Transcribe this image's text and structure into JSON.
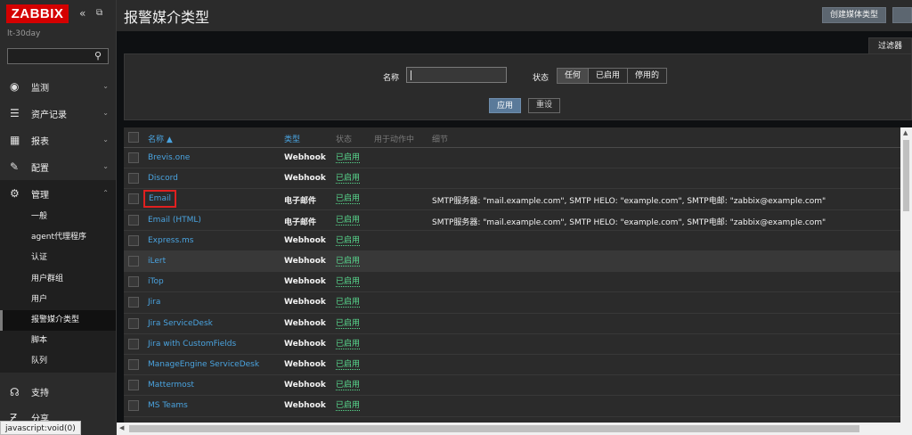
{
  "app": {
    "logo": "ZABBIX",
    "server_name": "lt-30day"
  },
  "search": {
    "value": "",
    "placeholder": ""
  },
  "menu": [
    {
      "label": "监测",
      "icon": "eye-icon"
    },
    {
      "label": "资产记录",
      "icon": "list-icon"
    },
    {
      "label": "报表",
      "icon": "chart-icon"
    },
    {
      "label": "配置",
      "icon": "wrench-icon"
    },
    {
      "label": "管理",
      "icon": "gear-icon"
    }
  ],
  "submenu": [
    {
      "label": "一般"
    },
    {
      "label": "agent代理程序"
    },
    {
      "label": "认证"
    },
    {
      "label": "用户群组"
    },
    {
      "label": "用户"
    },
    {
      "label": "报警媒介类型"
    },
    {
      "label": "脚本"
    },
    {
      "label": "队列"
    }
  ],
  "bottom_menu": [
    {
      "label": "支持",
      "icon": "headset-icon"
    },
    {
      "label": "分享",
      "icon": "share-icon"
    }
  ],
  "status_tip": "javascript:void(0)",
  "header": {
    "title": "报警媒介类型",
    "create_button": "创建媒体类型"
  },
  "filter": {
    "tab_label": "过滤器",
    "name_label": "名称",
    "name_value": "",
    "status_label": "状态",
    "status_options": [
      "任何",
      "已启用",
      "停用的"
    ],
    "selected_status": "任何",
    "apply_label": "应用",
    "reset_label": "重设"
  },
  "table": {
    "columns": [
      "名称 ▲",
      "类型",
      "状态",
      "用于动作中",
      "细节"
    ],
    "rows": [
      {
        "name": "Brevis.one",
        "type": "Webhook",
        "status": "已启用",
        "details": ""
      },
      {
        "name": "Discord",
        "type": "Webhook",
        "status": "已启用",
        "details": ""
      },
      {
        "name": "Email",
        "type": "电子邮件",
        "status": "已启用",
        "details": "SMTP服务器: \"mail.example.com\", SMTP HELO: \"example.com\", SMTP电邮: \"zabbix@example.com\""
      },
      {
        "name": "Email (HTML)",
        "type": "电子邮件",
        "status": "已启用",
        "details": "SMTP服务器: \"mail.example.com\", SMTP HELO: \"example.com\", SMTP电邮: \"zabbix@example.com\""
      },
      {
        "name": "Express.ms",
        "type": "Webhook",
        "status": "已启用",
        "details": ""
      },
      {
        "name": "iLert",
        "type": "Webhook",
        "status": "已启用",
        "details": ""
      },
      {
        "name": "iTop",
        "type": "Webhook",
        "status": "已启用",
        "details": ""
      },
      {
        "name": "Jira",
        "type": "Webhook",
        "status": "已启用",
        "details": ""
      },
      {
        "name": "Jira ServiceDesk",
        "type": "Webhook",
        "status": "已启用",
        "details": ""
      },
      {
        "name": "Jira with CustomFields",
        "type": "Webhook",
        "status": "已启用",
        "details": ""
      },
      {
        "name": "ManageEngine ServiceDesk",
        "type": "Webhook",
        "status": "已启用",
        "details": ""
      },
      {
        "name": "Mattermost",
        "type": "Webhook",
        "status": "已启用",
        "details": ""
      },
      {
        "name": "MS Teams",
        "type": "Webhook",
        "status": "已启用",
        "details": ""
      }
    ]
  },
  "colors": {
    "logo_red": "#d40000",
    "link_blue": "#4aa3df",
    "enabled_green": "#59db8f",
    "highlight_red": "#e02020"
  }
}
